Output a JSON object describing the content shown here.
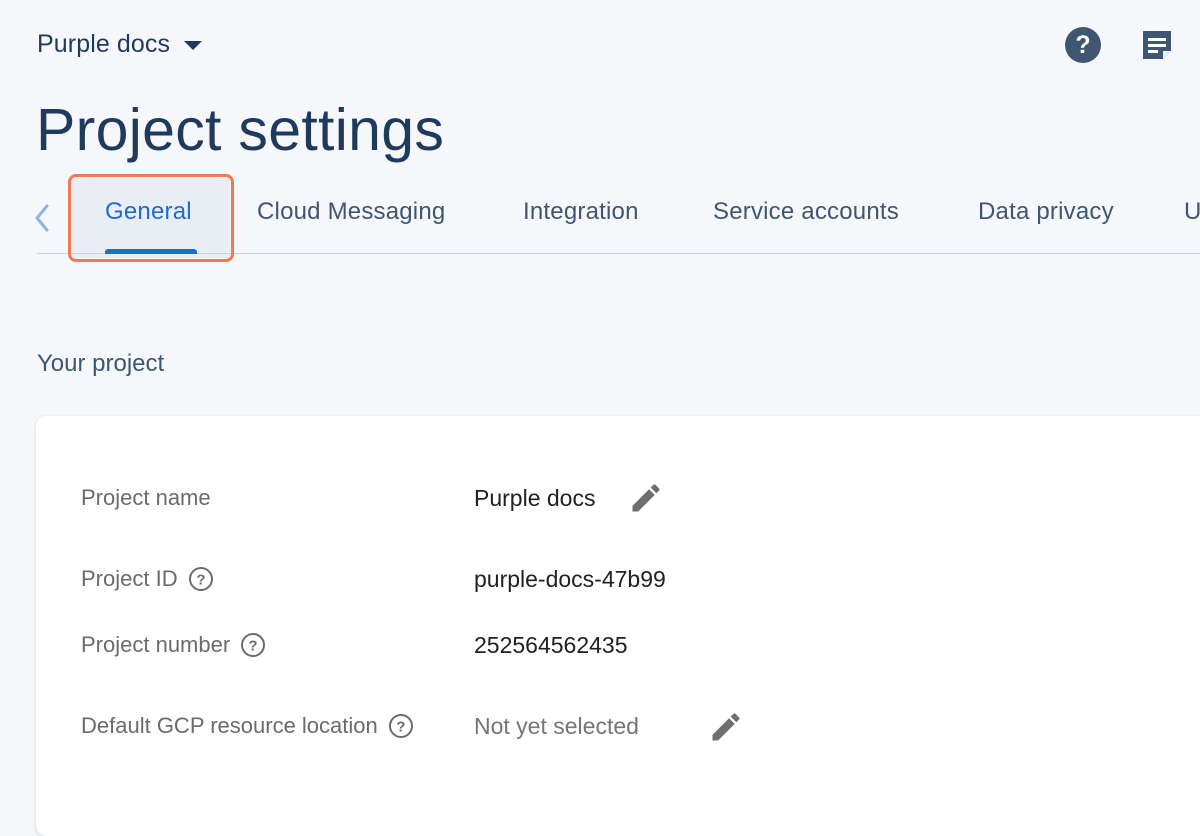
{
  "header": {
    "project_name": "Purple docs",
    "page_title": "Project settings"
  },
  "tabs": [
    {
      "label": "General",
      "active": true
    },
    {
      "label": "Cloud Messaging",
      "active": false
    },
    {
      "label": "Integration",
      "active": false
    },
    {
      "label": "Service accounts",
      "active": false
    },
    {
      "label": "Data privacy",
      "active": false
    },
    {
      "label": "U",
      "active": false
    }
  ],
  "section": {
    "heading": "Your project"
  },
  "fields": [
    {
      "label": "Project name",
      "value": "Purple docs"
    },
    {
      "label": "Project ID",
      "value": "purple-docs-47b99"
    },
    {
      "label": "Project number",
      "value": "252564562435"
    },
    {
      "label": "Default GCP resource location",
      "value": "Not yet selected"
    }
  ],
  "colors": {
    "accent": "#1f6cc9",
    "title": "#1f3a5c",
    "highlight": "#f07a52"
  },
  "icons": [
    "caret-down-icon",
    "help-icon",
    "notes-icon",
    "chevron-left-icon",
    "help-small-icon",
    "edit-icon"
  ]
}
